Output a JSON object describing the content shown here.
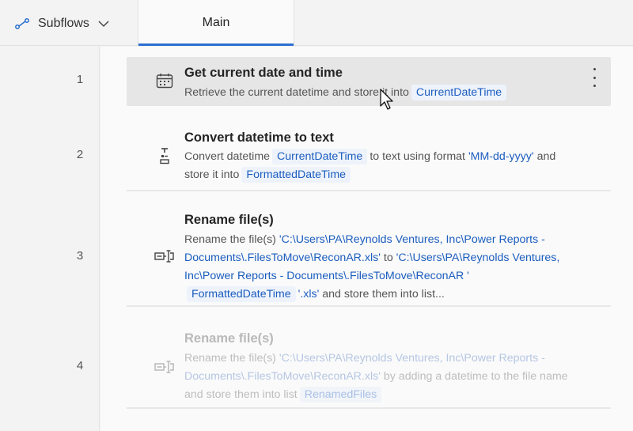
{
  "header": {
    "subflows_label": "Subflows",
    "main_tab_label": "Main"
  },
  "colors": {
    "accent": "#2b6fd0",
    "variable_text": "#1b5dbf",
    "selected_row": "#e6e6e6"
  },
  "steps": [
    {
      "number": "1",
      "icon": "calendar-icon",
      "title": "Get current date and time",
      "desc_part1": "Retrieve the current datetime and store it into",
      "var1": "CurrentDateTime"
    },
    {
      "number": "2",
      "icon": "convert-text-icon",
      "title": "Convert datetime to text",
      "desc_part1": "Convert datetime",
      "var1": "CurrentDateTime",
      "desc_part2": "to text using format",
      "str1": "'MM-dd-yyyy'",
      "desc_part3": "and store it into",
      "var2": "FormattedDateTime"
    },
    {
      "number": "3",
      "icon": "rename-file-icon",
      "title": "Rename file(s)",
      "desc_part1": "Rename the file(s)",
      "str1": "'C:\\Users\\PA\\Reynolds Ventures, Inc\\Power Reports - Documents\\.FilesToMove\\ReconAR.xls'",
      "desc_part2": "to",
      "str2": "'C:\\Users\\PA\\Reynolds Ventures, Inc\\Power Reports - Documents\\.FilesToMove\\ReconAR '",
      "var1": "FormattedDateTime",
      "str3": "'.xls'",
      "desc_part3": "and store them into list..."
    },
    {
      "number": "4",
      "icon": "rename-file-icon",
      "title": "Rename file(s)",
      "desc_part1": "Rename the file(s)",
      "str1": "'C:\\Users\\PA\\Reynolds Ventures, Inc\\Power Reports - Documents\\.FilesToMove\\ReconAR.xls'",
      "desc_part2": "by adding a datetime to the file name and store them into list",
      "var1": "RenamedFiles"
    }
  ]
}
